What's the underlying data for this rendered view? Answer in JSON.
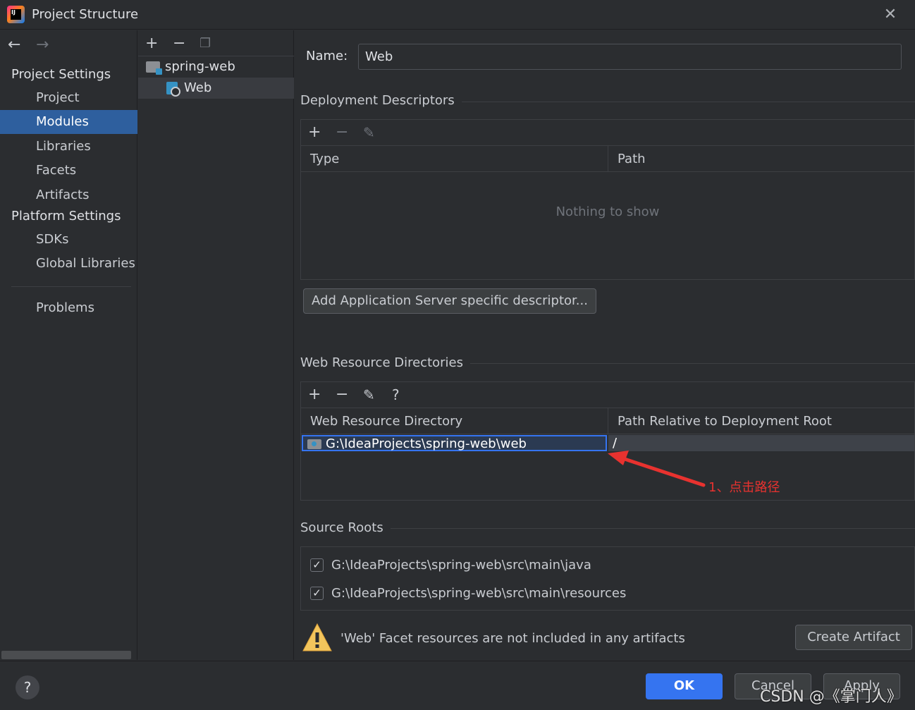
{
  "window": {
    "title": "Project Structure",
    "close_icon": "close-icon"
  },
  "sidebar": {
    "project_settings_header": "Project Settings",
    "project_items": [
      {
        "label": "Project"
      },
      {
        "label": "Modules",
        "selected": true
      },
      {
        "label": "Libraries"
      },
      {
        "label": "Facets"
      },
      {
        "label": "Artifacts"
      }
    ],
    "platform_settings_header": "Platform Settings",
    "platform_items": [
      {
        "label": "SDKs"
      },
      {
        "label": "Global Libraries"
      }
    ],
    "problems_label": "Problems"
  },
  "modules_tree": {
    "items": [
      {
        "label": "spring-web",
        "icon": "module-folder-icon"
      },
      {
        "label": "Web",
        "icon": "web-facet-icon",
        "selected": true
      }
    ]
  },
  "main": {
    "name_label": "Name:",
    "name_value": "Web",
    "deployment": {
      "title": "Deployment Descriptors",
      "col_type": "Type",
      "col_path": "Path",
      "empty_text": "Nothing to show",
      "add_button": "Add Application Server specific descriptor..."
    },
    "web_resources": {
      "title": "Web Resource Directories",
      "col_dir": "Web Resource Directory",
      "col_rel": "Path Relative to Deployment Root",
      "rows": [
        {
          "dir": "G:\\IdeaProjects\\spring-web\\web",
          "rel": "/"
        }
      ],
      "help_glyph": "?"
    },
    "source_roots": {
      "title": "Source Roots",
      "items": [
        {
          "path": "G:\\IdeaProjects\\spring-web\\src\\main\\java",
          "checked": true
        },
        {
          "path": "G:\\IdeaProjects\\spring-web\\src\\main\\resources",
          "checked": true
        }
      ]
    },
    "warning_text": "'Web' Facet resources are not included in any artifacts",
    "create_artifact_button": "Create Artifact"
  },
  "footer": {
    "help_glyph": "?",
    "ok_label": "OK",
    "cancel_label": "Cancel",
    "apply_label": "Apply"
  },
  "annotation": {
    "text": "1、点击路径",
    "color": "#e8322f"
  },
  "watermark": "CSDN @《掌门人》",
  "colors": {
    "accent": "#3574f0",
    "selection": "#2e5f9e",
    "background": "#2b2d30"
  }
}
